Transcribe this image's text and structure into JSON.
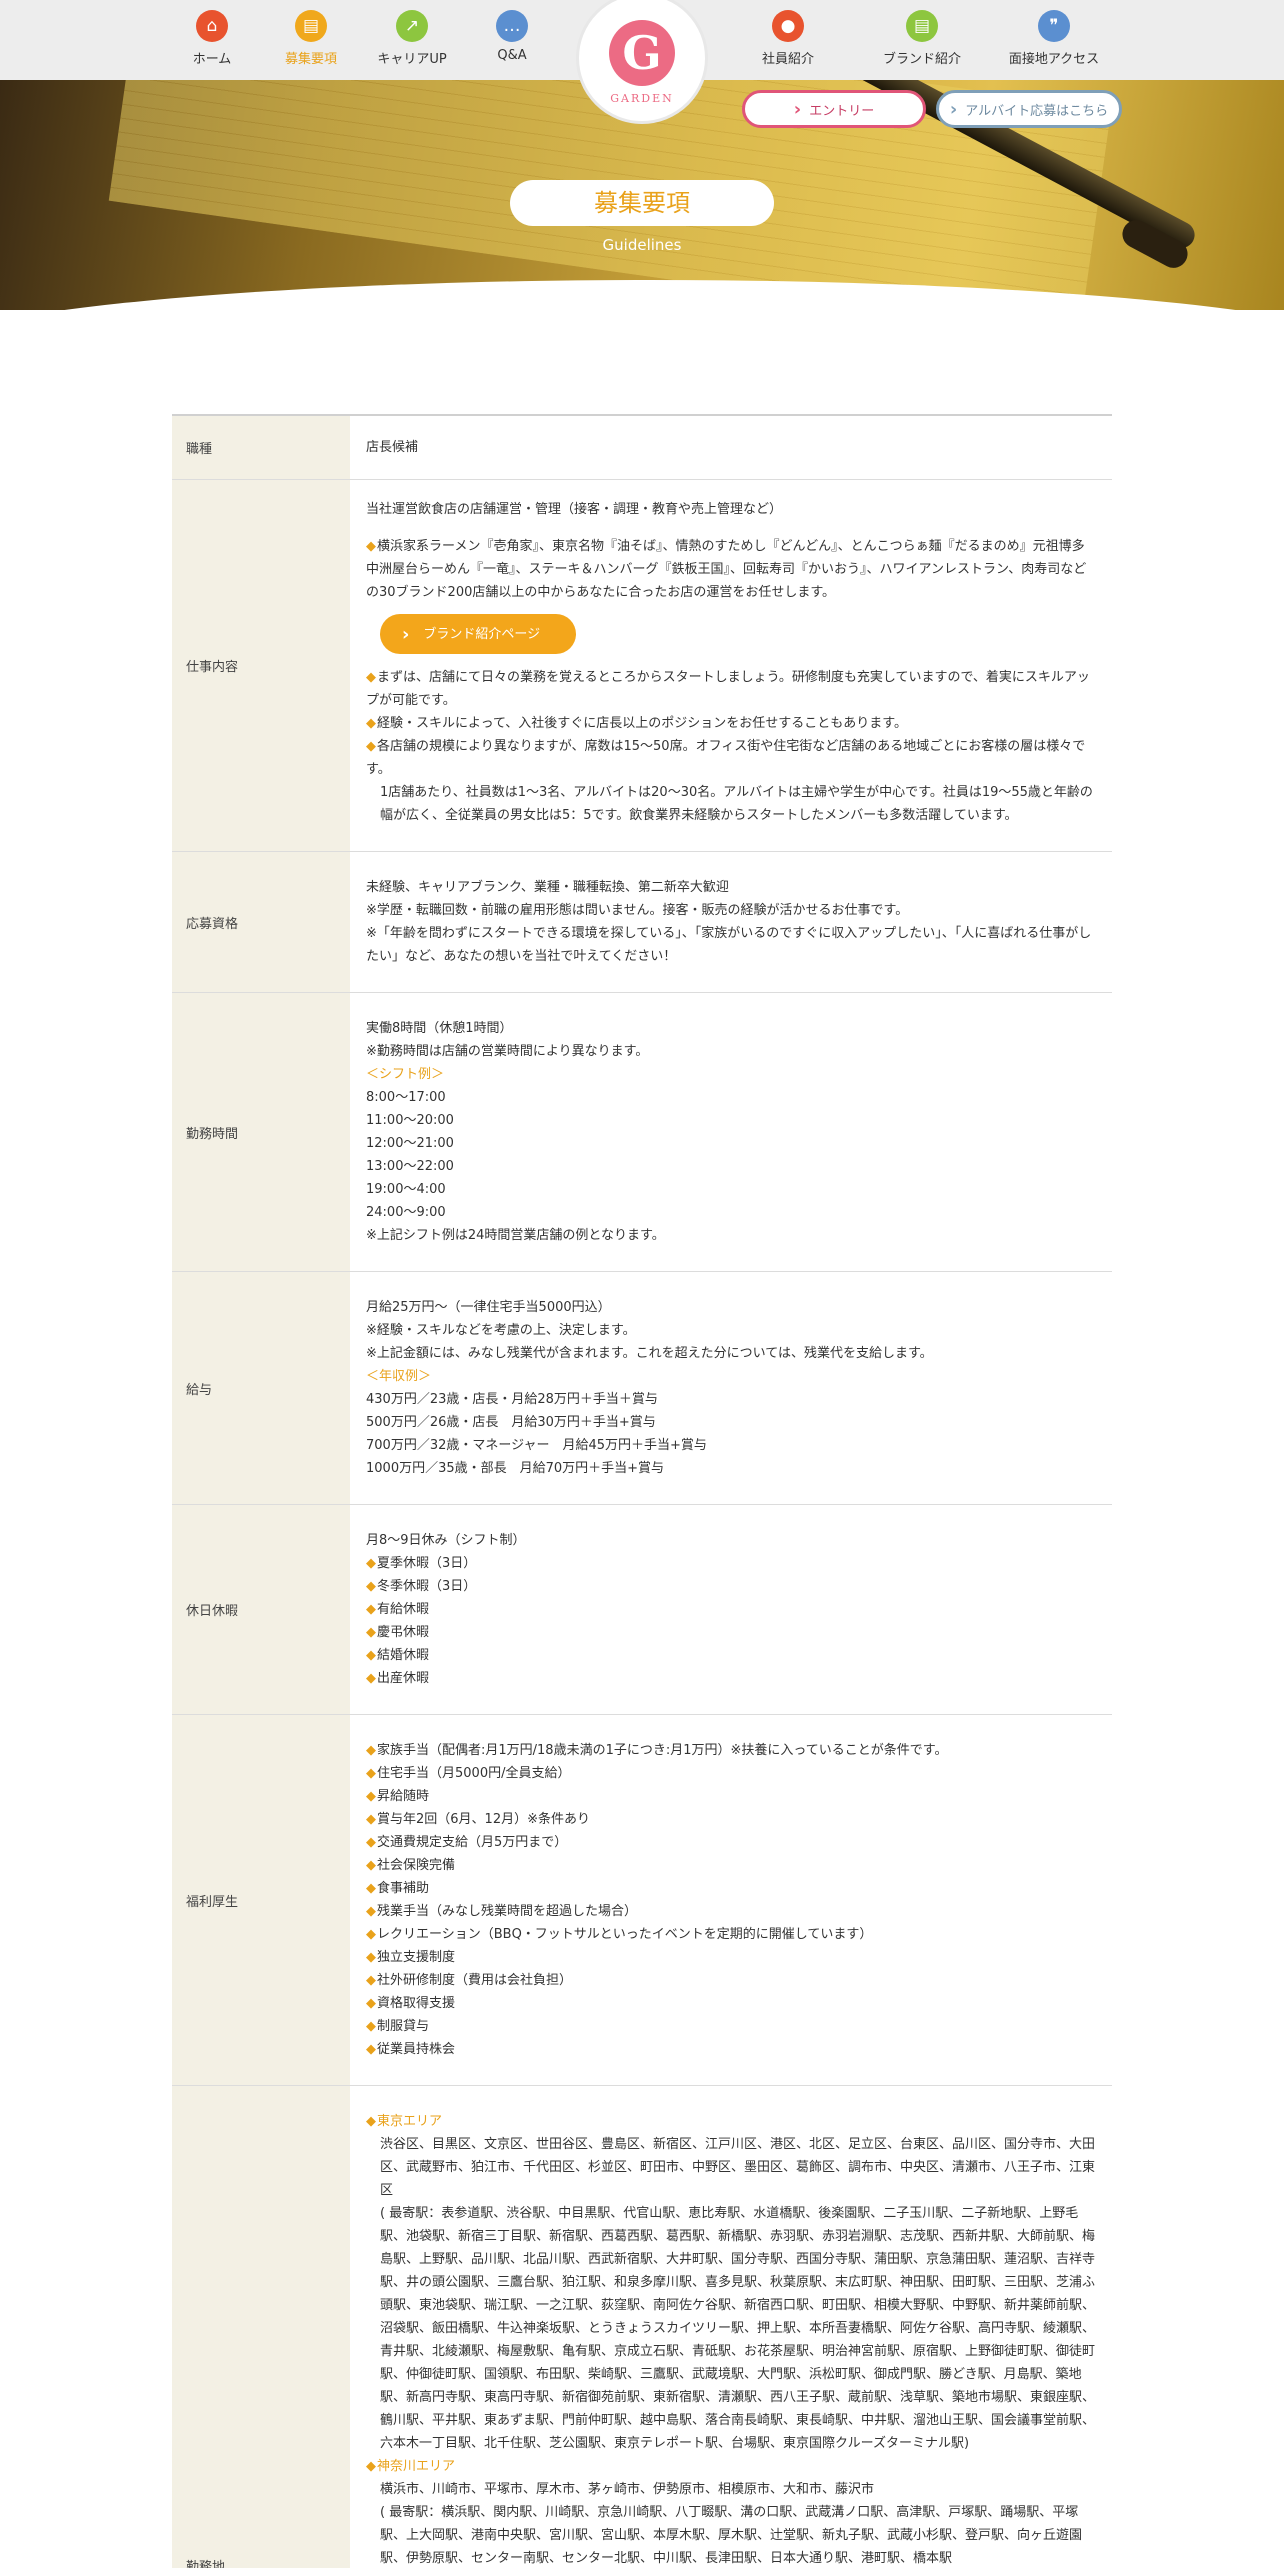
{
  "nav": {
    "items_left": [
      {
        "label": "ホーム",
        "icon": "home-icon",
        "color": "#e8532e"
      },
      {
        "label": "募集要項",
        "icon": "document-icon",
        "color": "#f0a81c",
        "active": true
      },
      {
        "label": "キャリアUP",
        "icon": "arrow-up-icon",
        "color": "#8dc63f"
      },
      {
        "label": "Q&A",
        "icon": "chat-bubble-icon",
        "color": "#5b8fd0"
      }
    ],
    "items_right": [
      {
        "label": "社員紹介",
        "icon": "person-icon",
        "color": "#e8532e"
      },
      {
        "label": "ブランド紹介",
        "icon": "document-icon",
        "color": "#8dc63f"
      },
      {
        "label": "面接地アクセス",
        "icon": "footprints-icon",
        "color": "#5b8fd0"
      }
    ],
    "logo_letter": "G",
    "logo_text": "GARDEN"
  },
  "hero": {
    "entry_label": "エントリー",
    "part_time_label": "アルバイト応募はこちら",
    "title": "募集要項",
    "subtitle": "Guidelines"
  },
  "guide": {
    "role": {
      "label": "職種",
      "value": "店長候補"
    },
    "work": {
      "label": "仕事内容",
      "intro": "当社運営飲食店の店舗運営・管理（接客・調理・教育や売上管理など）",
      "brands": "横浜家系ラーメン『壱角家』、東京名物『油そば』、情熱のすためし『どんどん』、とんこつらぁ麺『だるまのめ』元祖博多中洲屋台らーめん『一竜』、ステーキ＆ハンバーグ『鉄板王国』、回転寿司『かいおう』、ハワイアンレストラン、肉寿司などの30ブランド200店舗以上の中からあなたに合ったお店の運営をお任せします。",
      "brand_button": "ブランド紹介ページ",
      "point1": "まずは、店舗にて日々の業務を覚えるところからスタートしましょう。研修制度も充実していますので、着実にスキルアップが可能です。",
      "point2": "経験・スキルによって、入社後すぐに店長以上のポジションをお任せすることもあります。",
      "point3": "各店舗の規模により異なりますが、席数は15～50席。オフィス街や住宅街など店舗のある地域ごとにお客様の層は様々です。",
      "point4": "1店舗あたり、社員数は1～3名、アルバイトは20～30名。アルバイトは主婦や学生が中心です。社員は19～55歳と年齢の幅が広く、全従業員の男女比は5：5です。飲食業界未経験からスタートしたメンバーも多数活躍しています。"
    },
    "qual": {
      "label": "応募資格",
      "line1": "未経験、キャリアブランク、業種・職種転換、第二新卒大歓迎",
      "line2": "※学歴・転職回数・前職の雇用形態は問いません。接客・販売の経験が活かせるお仕事です。",
      "line3": "※「年齢を問わずにスタートできる環境を探している」、「家族がいるのですぐに収入アップしたい」、「人に喜ばれる仕事がしたい」など、あなたの想いを当社で叶えてください！"
    },
    "hours": {
      "label": "勤務時間",
      "line1": "実働8時間（休憩1時間）",
      "line2": "※勤務時間は店舗の営業時間により異なります。",
      "shift_head": "＜シフト例＞",
      "shifts": [
        "8:00～17:00",
        "11:00～20:00",
        "12:00～21:00",
        "13:00～22:00",
        "19:00～4:00",
        "24:00～9:00"
      ],
      "note": "※上記シフト例は24時間営業店舗の例となります。"
    },
    "salary": {
      "label": "給与",
      "line1": "月給25万円～（一律住宅手当5000円込）",
      "line2": "※経験・スキルなどを考慮の上、決定します。",
      "line3": "※上記金額には、みなし残業代が含まれます。これを超えた分については、残業代を支給します。",
      "annual_head": "＜年収例＞",
      "examples": [
        "430万円／23歳・店長・月給28万円＋手当＋賞与",
        "500万円／26歳・店長　月給30万円＋手当+賞与",
        "700万円／32歳・マネージャー　月給45万円＋手当+賞与",
        "1000万円／35歳・部長　月給70万円＋手当+賞与"
      ]
    },
    "holidays": {
      "label": "休日休暇",
      "line1": "月8～9日休み（シフト制）",
      "items": [
        "夏季休暇（3日）",
        "冬季休暇（3日）",
        "有給休暇",
        "慶弔休暇",
        "結婚休暇",
        "出産休暇"
      ]
    },
    "welfare": {
      "label": "福利厚生",
      "items": [
        "家族手当（配偶者:月1万円/18歳未満の1子につき:月1万円）※扶養に入っていることが条件です。",
        "住宅手当（月5000円/全員支給）",
        "昇給随時",
        "賞与年2回（6月、12月）※条件あり",
        "交通費規定支給（月5万円まで）",
        "社会保険完備",
        "食事補助",
        "残業手当（みなし残業時間を超過した場合）",
        "レクリエーション（BBQ・フットサルといったイベントを定期的に開催しています）",
        "独立支援制度",
        "社外研修制度（費用は会社負担）",
        "資格取得支援",
        "制服貸与",
        "従業員持株会"
      ]
    },
    "location": {
      "label": "勤務地",
      "tokyo_head": "東京エリア",
      "tokyo_cities": "渋谷区、目黒区、文京区、世田谷区、豊島区、新宿区、江戸川区、港区、北区、足立区、台東区、品川区、国分寺市、大田区、武蔵野市、狛江市、千代田区、杉並区、町田市、中野区、墨田区、葛飾区、調布市、中央区、清瀬市、八王子市、江東区",
      "tokyo_stations": "( 最寄駅：表参道駅、渋谷駅、中目黒駅、代官山駅、恵比寿駅、水道橋駅、後楽園駅、二子玉川駅、二子新地駅、上野毛駅、池袋駅、新宿三丁目駅、新宿駅、西葛西駅、葛西駅、新橋駅、赤羽駅、赤羽岩淵駅、志茂駅、西新井駅、大師前駅、梅島駅、上野駅、品川駅、北品川駅、西武新宿駅、大井町駅、国分寺駅、西国分寺駅、蒲田駅、京急蒲田駅、蓮沼駅、吉祥寺駅、井の頭公園駅、三鷹台駅、狛江駅、和泉多摩川駅、喜多見駅、秋葉原駅、末広町駅、神田駅、田町駅、三田駅、芝浦ふ頭駅、東池袋駅、瑞江駅、一之江駅、荻窪駅、南阿佐ケ谷駅、新宿西口駅、町田駅、相模大野駅、中野駅、新井薬師前駅、沼袋駅、飯田橋駅、牛込神楽坂駅、とうきょうスカイツリー駅、押上駅、本所吾妻橋駅、阿佐ケ谷駅、高円寺駅、綾瀬駅、青井駅、北綾瀬駅、梅屋敷駅、亀有駅、京成立石駅、青砥駅、お花茶屋駅、明治神宮前駅、原宿駅、上野御徒町駅、御徒町駅、仲御徒町駅、国領駅、布田駅、柴崎駅、三鷹駅、武蔵境駅、大門駅、浜松町駅、御成門駅、勝どき駅、月島駅、築地駅、新高円寺駅、東高円寺駅、新宿御苑前駅、東新宿駅、清瀬駅、西八王子駅、蔵前駅、浅草駅、築地市場駅、東銀座駅、鶴川駅、平井駅、東あずま駅、門前仲町駅、越中島駅、落合南長崎駅、東長崎駅、中井駅、溜池山王駅、国会議事堂前駅、六本木一丁目駅、北千住駅、芝公園駅、東京テレポート駅、台場駅、東京国際クルーズターミナル駅)",
      "kanagawa_head": "神奈川エリア",
      "kanagawa_cities": "横浜市、川崎市、平塚市、厚木市、茅ヶ崎市、伊勢原市、相模原市、大和市、藤沢市",
      "kanagawa_stations": "( 最寄駅：横浜駅、関内駅、川崎駅、京急川崎駅、八丁畷駅、溝の口駅、武蔵溝ノ口駅、高津駅、戸塚駅、踊場駅、平塚駅、上大岡駅、港南中央駅、宮川駅、宮山駅、本厚木駅、厚木駅、辻堂駅、新丸子駅、武蔵小杉駅、登戸駅、向ヶ丘遊園駅、伊勢原駅、センター南駅、センター北駅、中川駅、長津田駅、日本大通り駅、港町駅、橋本駅"
    }
  }
}
